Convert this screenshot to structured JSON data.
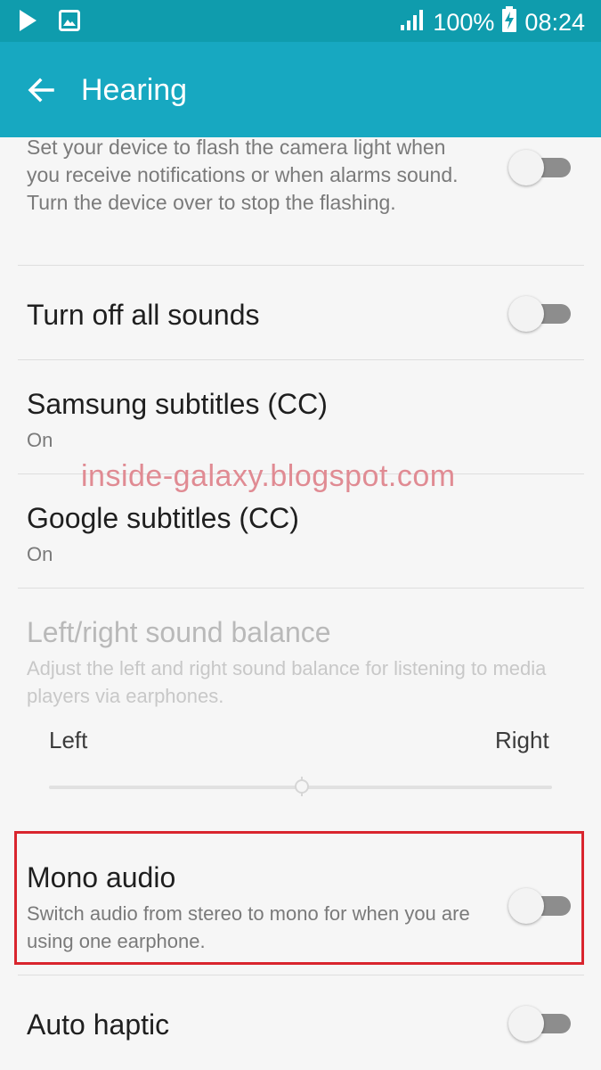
{
  "status_bar": {
    "battery": "100%",
    "time": "08:24",
    "icons": [
      "play-icon",
      "gallery-icon",
      "signal-icon",
      "battery-charging-icon"
    ]
  },
  "app_bar": {
    "title": "Hearing",
    "back_icon": "arrow-left-icon",
    "color": "#17a8c1"
  },
  "settings": {
    "flash_notification": {
      "description": "Set your device to flash the camera light when you receive notifications or when alarms sound. Turn the device over to stop the flashing.",
      "enabled": false
    },
    "turn_off_all_sounds": {
      "title": "Turn off all sounds",
      "enabled": false
    },
    "samsung_subtitles": {
      "title": "Samsung subtitles (CC)",
      "summary": "On"
    },
    "google_subtitles": {
      "title": "Google subtitles (CC)",
      "summary": "On"
    },
    "sound_balance": {
      "title": "Left/right sound balance",
      "description": "Adjust the left and right sound balance for listening to media players via earphones.",
      "left_label": "Left",
      "right_label": "Right",
      "balance_fraction": 0.5
    },
    "mono_audio": {
      "title": "Mono audio",
      "description": "Switch audio from stereo to mono for when you are using one earphone.",
      "enabled": false
    },
    "auto_haptic": {
      "title": "Auto haptic",
      "enabled": false
    }
  },
  "watermark": "inside-galaxy.blogspot.com",
  "colors": {
    "status_bar": "#0f9cad",
    "highlight": "#d9252e"
  }
}
